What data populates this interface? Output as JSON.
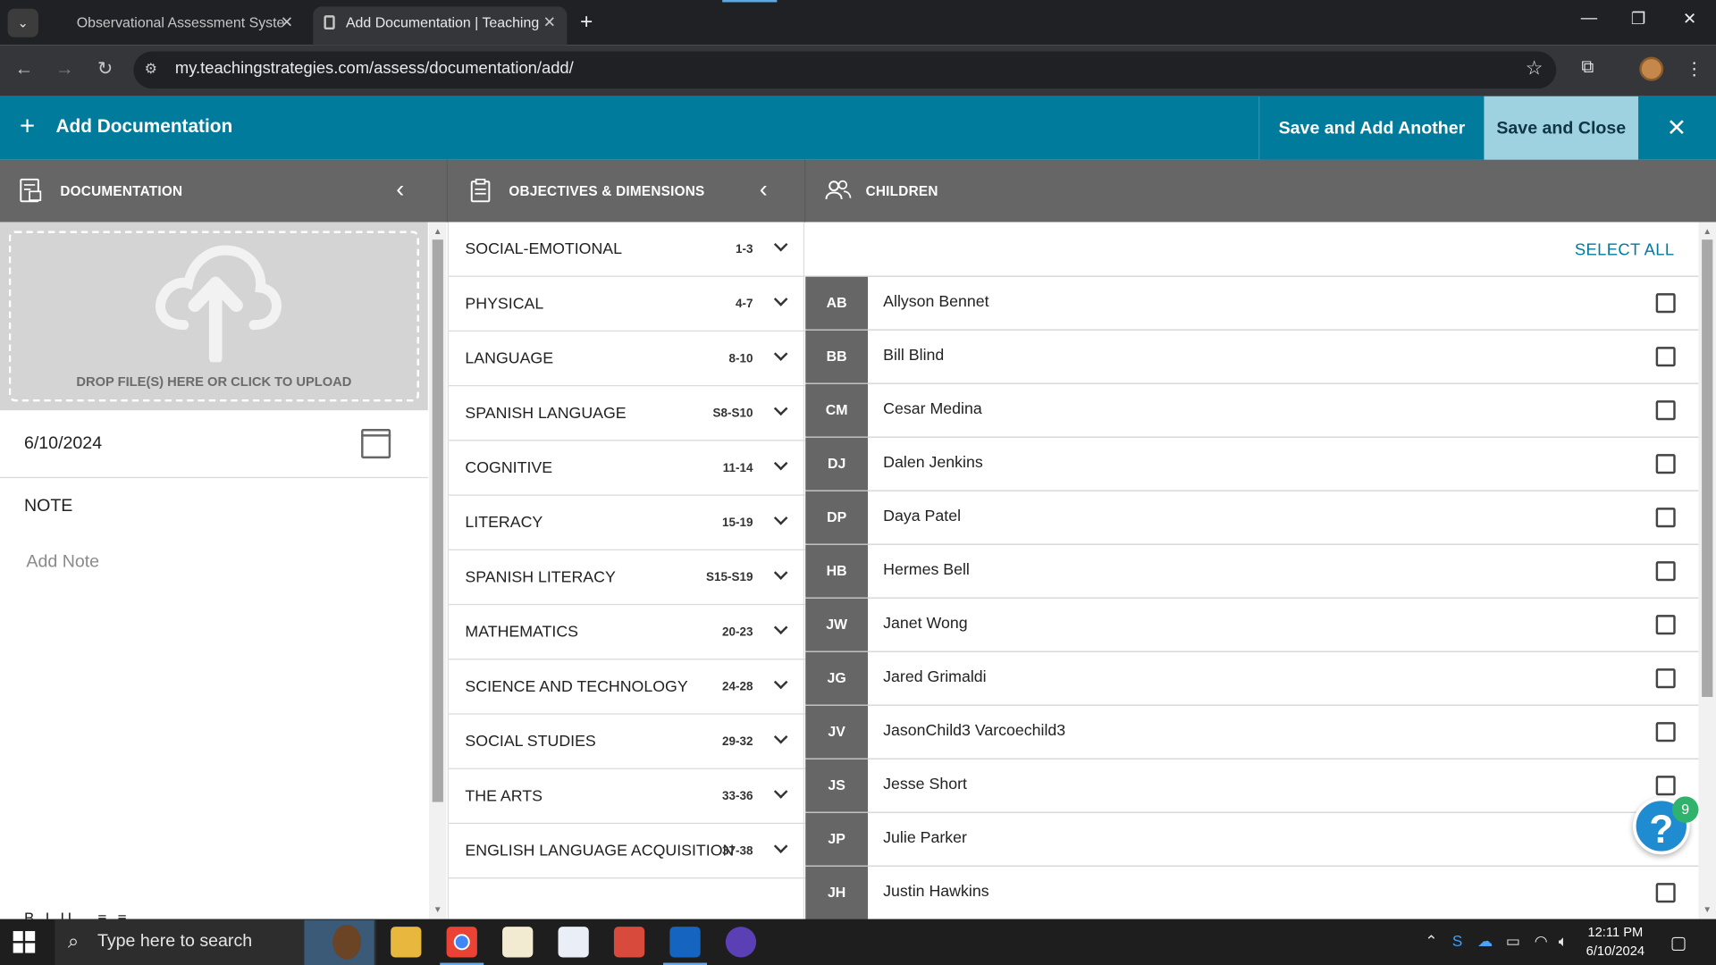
{
  "browser": {
    "tabs": [
      {
        "title": "Observational Assessment Syste"
      },
      {
        "title": "Add Documentation | Teaching"
      }
    ],
    "url": "my.teachingstrategies.com/assess/documentation/add/"
  },
  "header": {
    "title": "Add Documentation",
    "save_add_label": "Save and Add Another",
    "save_close_label": "Save and Close"
  },
  "sections": {
    "documentation": "DOCUMENTATION",
    "objectives": "OBJECTIVES & DIMENSIONS",
    "children": "CHILDREN"
  },
  "documentation": {
    "upload_text": "DROP FILE(S) HERE OR CLICK TO UPLOAD",
    "date": "6/10/2024",
    "note_label": "NOTE",
    "note_placeholder": "Add Note"
  },
  "objectives": [
    {
      "name": "SOCIAL-EMOTIONAL",
      "range": "1-3"
    },
    {
      "name": "PHYSICAL",
      "range": "4-7"
    },
    {
      "name": "LANGUAGE",
      "range": "8-10"
    },
    {
      "name": "SPANISH LANGUAGE",
      "range": "S8-S10"
    },
    {
      "name": "COGNITIVE",
      "range": "11-14"
    },
    {
      "name": "LITERACY",
      "range": "15-19"
    },
    {
      "name": "SPANISH LITERACY",
      "range": "S15-S19"
    },
    {
      "name": "MATHEMATICS",
      "range": "20-23"
    },
    {
      "name": "SCIENCE AND TECHNOLOGY",
      "range": "24-28"
    },
    {
      "name": "SOCIAL STUDIES",
      "range": "29-32"
    },
    {
      "name": "THE ARTS",
      "range": "33-36"
    },
    {
      "name": "ENGLISH LANGUAGE ACQUISITION",
      "range": "37-38"
    }
  ],
  "children": {
    "select_all": "SELECT ALL",
    "list": [
      {
        "initials": "AB",
        "name": "Allyson Bennet"
      },
      {
        "initials": "BB",
        "name": "Bill Blind"
      },
      {
        "initials": "CM",
        "name": "Cesar Medina"
      },
      {
        "initials": "DJ",
        "name": "Dalen Jenkins"
      },
      {
        "initials": "DP",
        "name": "Daya Patel"
      },
      {
        "initials": "HB",
        "name": "Hermes Bell"
      },
      {
        "initials": "JW",
        "name": "Janet Wong"
      },
      {
        "initials": "JG",
        "name": "Jared Grimaldi"
      },
      {
        "initials": "JV",
        "name": "JasonChild3 Varcoechild3"
      },
      {
        "initials": "JS",
        "name": "Jesse Short"
      },
      {
        "initials": "JP",
        "name": "Julie Parker"
      },
      {
        "initials": "JH",
        "name": "Justin Hawkins"
      }
    ]
  },
  "help": {
    "badge": "9",
    "glyph": "?"
  },
  "taskbar": {
    "search_placeholder": "Type here to search",
    "time": "12:11 PM",
    "date": "6/10/2024"
  }
}
